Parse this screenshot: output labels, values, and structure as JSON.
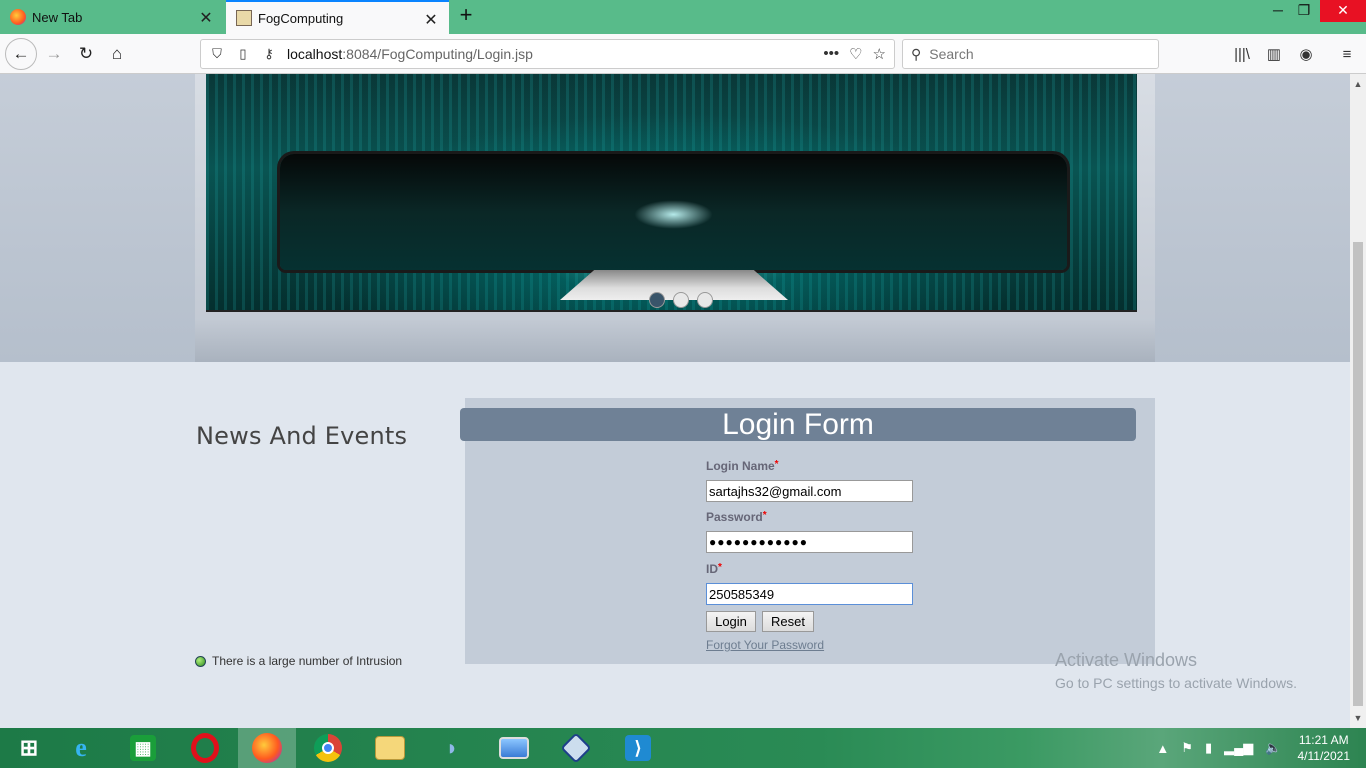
{
  "browser": {
    "tabs": [
      {
        "label": "New Tab",
        "active": false
      },
      {
        "label": "FogComputing",
        "active": true
      }
    ],
    "url": {
      "host": "localhost",
      "path": ":8084/FogComputing/Login.jsp"
    },
    "search_placeholder": "Search"
  },
  "slider": {
    "dots": 3,
    "active_dot": 1
  },
  "news": {
    "title": "News And Events",
    "items": [
      "There is a large number of Intrusion"
    ]
  },
  "login_form": {
    "title": "Login Form",
    "login_name_label": "Login Name",
    "login_name_value": "sartajhs32@gmail.com",
    "password_label": "Password",
    "password_value": "●●●●●●●●●●●●",
    "id_label": "ID",
    "id_value": "250585349",
    "required_mark": "*",
    "login_button": "Login",
    "reset_button": "Reset",
    "forgot_link": "Forgot Your Password"
  },
  "activation_notice": {
    "line1": "Activate Windows",
    "line2": "Go to PC settings to activate Windows."
  },
  "taskbar": {
    "time": "11:21 AM",
    "date": "4/11/2021",
    "apps": [
      "start",
      "internet-explorer",
      "store",
      "opera",
      "firefox",
      "chrome",
      "file-explorer",
      "dolphin",
      "photos",
      "virtualbox",
      "vscode"
    ]
  },
  "colors": {
    "tab_strip": "#58bb8a",
    "form_header": "#6f8196",
    "taskbar": "#2a8b55"
  }
}
